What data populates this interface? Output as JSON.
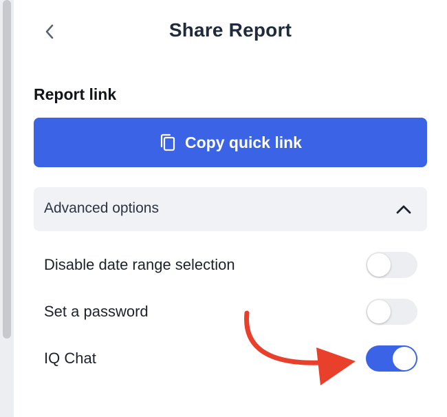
{
  "header": {
    "title": "Share Report",
    "back_icon": "chevron-left-icon"
  },
  "report_link": {
    "label": "Report link",
    "copy_button_label": "Copy quick link",
    "copy_icon": "copy-icon"
  },
  "advanced": {
    "label": "Advanced options",
    "expanded": true,
    "chevron_icon": "chevron-up-icon"
  },
  "options": [
    {
      "label": "Disable date range selection",
      "enabled": false
    },
    {
      "label": "Set a password",
      "enabled": false
    },
    {
      "label": "IQ Chat",
      "enabled": true
    }
  ],
  "colors": {
    "accent": "#3b63e6",
    "annotation_arrow": "#e8402a",
    "toggle_off": "#eceef1",
    "title": "#1f2b3d"
  }
}
